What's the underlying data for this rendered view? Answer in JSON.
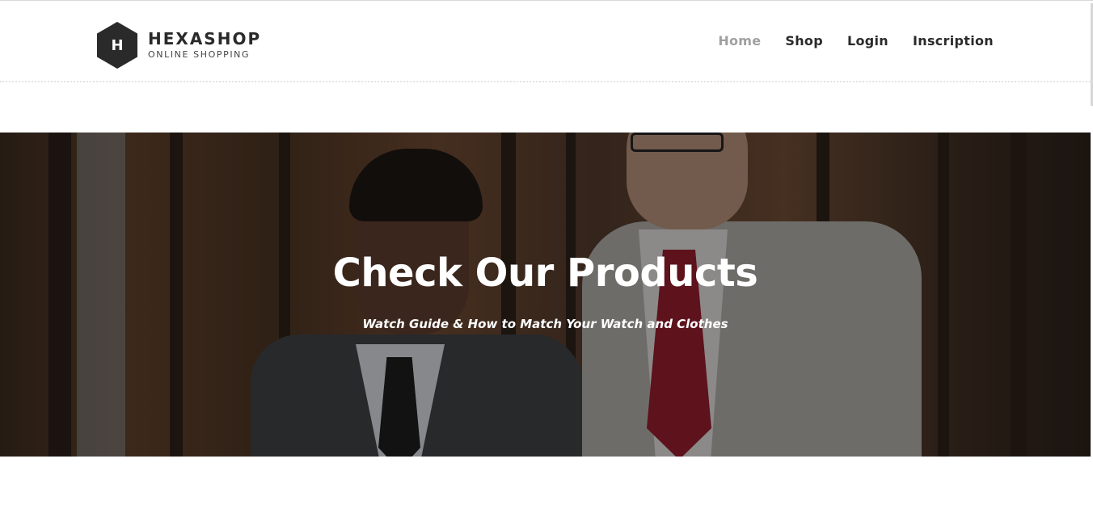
{
  "brand": {
    "logo_letter": "H",
    "name": "HEXASHOP",
    "tagline": "ONLINE SHOPPING"
  },
  "nav": {
    "items": [
      {
        "label": "Home",
        "active": true
      },
      {
        "label": "Shop",
        "active": false
      },
      {
        "label": "Login",
        "active": false
      },
      {
        "label": "Inscription",
        "active": false
      }
    ]
  },
  "hero": {
    "title": "Check Our Products",
    "subtitle": "Watch Guide & How to Match Your Watch and Clothes"
  },
  "colors": {
    "nav_active": "#a0a0a0",
    "nav_text": "#2a2a2a",
    "logo_bg": "#2a2a2a"
  }
}
